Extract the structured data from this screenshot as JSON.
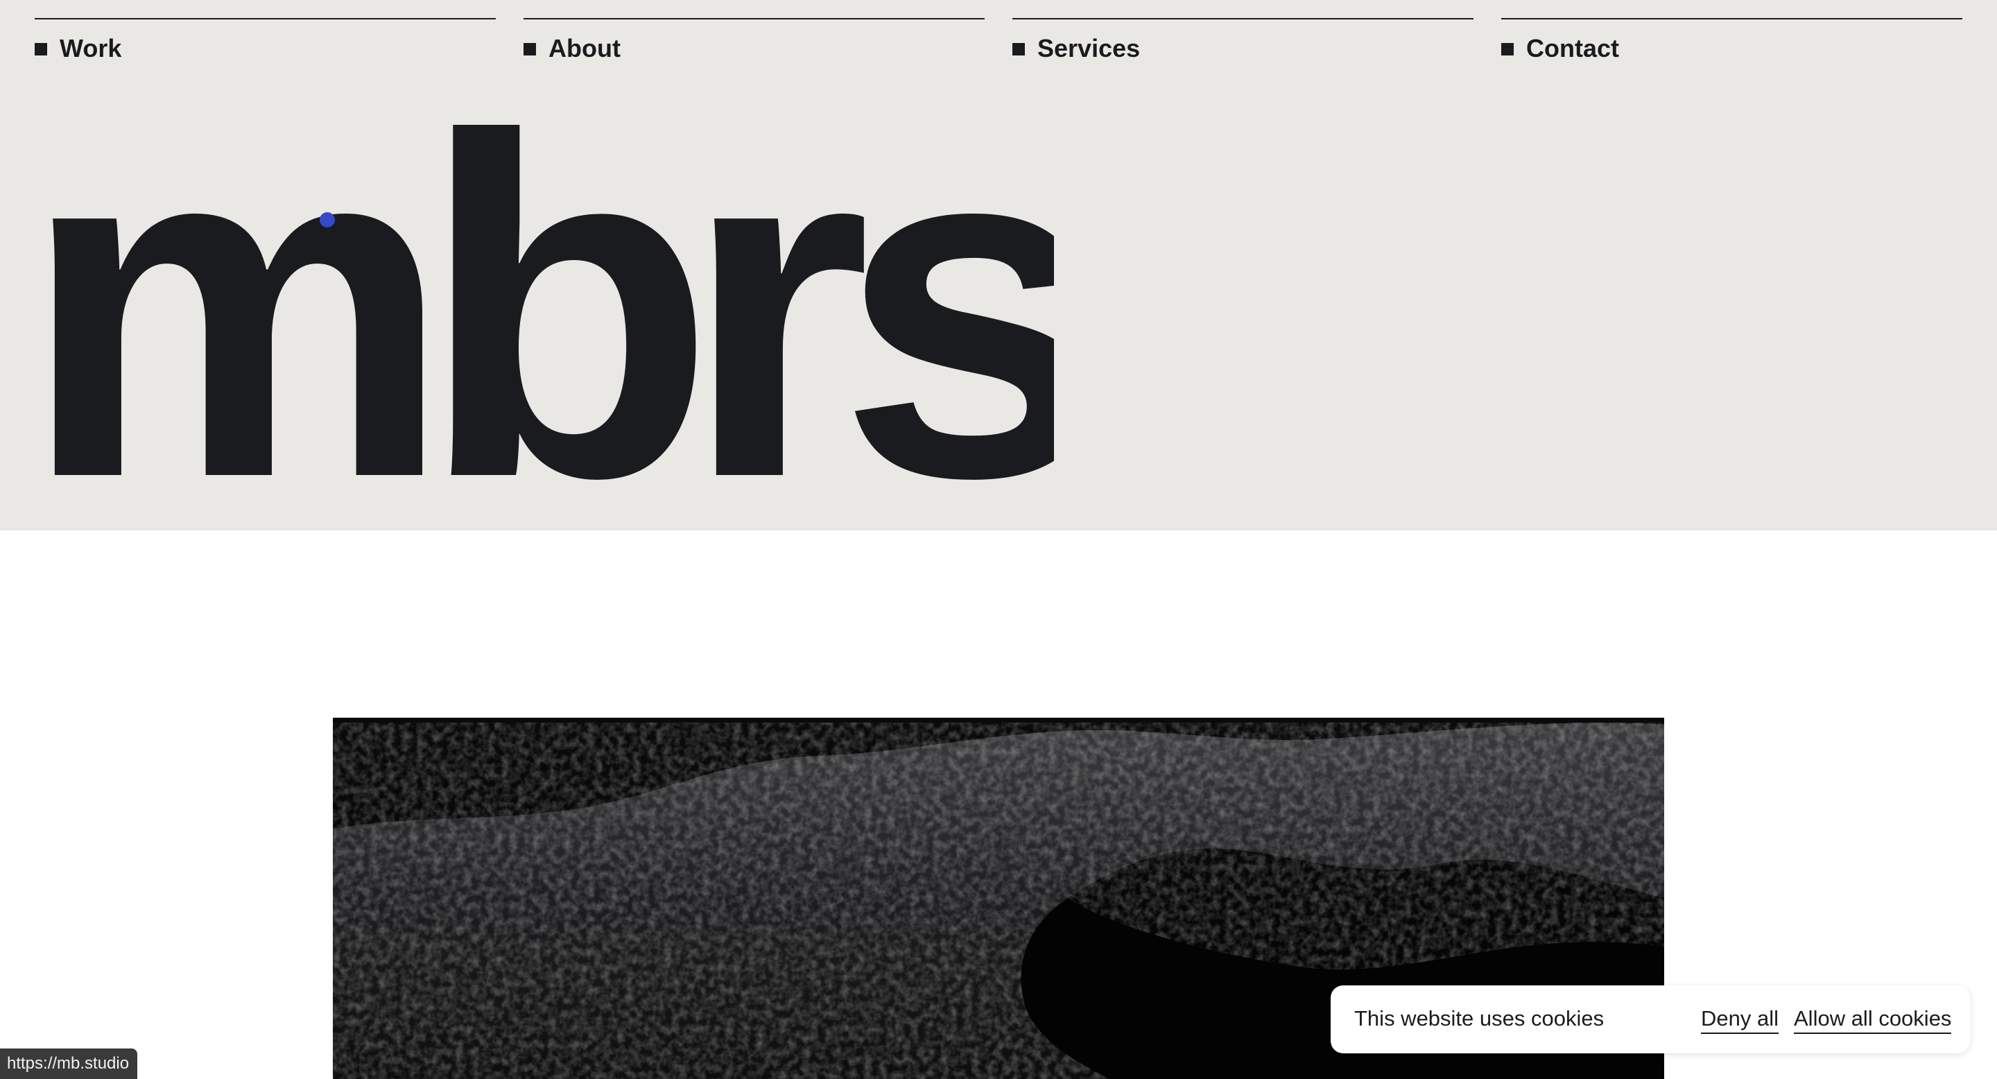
{
  "nav": {
    "items": [
      {
        "label": "Work"
      },
      {
        "label": "About"
      },
      {
        "label": "Services"
      },
      {
        "label": "Contact"
      }
    ]
  },
  "logo": {
    "text": "mbrs",
    "color": "#1a1b1f"
  },
  "cursor": {
    "color": "#3548c8"
  },
  "hero": {
    "image": "dark-rocky-landscape"
  },
  "cookie_banner": {
    "message": "This website uses cookies",
    "deny_label": "Deny all",
    "allow_label": "Allow all cookies"
  },
  "status_bar": {
    "url": "https://mb.studio"
  },
  "colors": {
    "header_bg": "#e9e8e4",
    "text": "#1a1b1f",
    "page_bg": "#ffffff"
  }
}
